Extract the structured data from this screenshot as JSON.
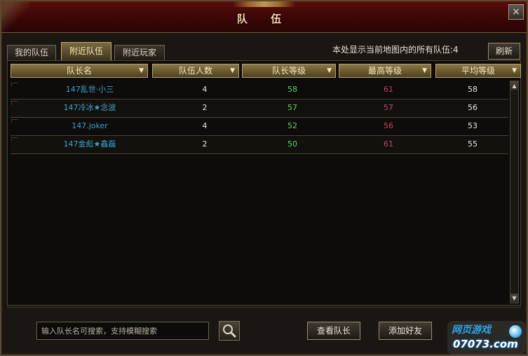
{
  "window": {
    "title": "队  伍",
    "close_label": "×"
  },
  "tabs": [
    {
      "label": "我的队伍"
    },
    {
      "label": "附近队伍"
    },
    {
      "label": "附近玩家"
    }
  ],
  "info": {
    "text": "本处显示当前地图内的所有队伍:4"
  },
  "toolbar": {
    "refresh_label": "刷新"
  },
  "table": {
    "columns": [
      {
        "label": "队长名"
      },
      {
        "label": "队伍人数"
      },
      {
        "label": "队长等级"
      },
      {
        "label": "最高等级"
      },
      {
        "label": "平均等级"
      }
    ],
    "rows": [
      {
        "leader": "147乱世·小三",
        "members": "4",
        "leader_level": "58",
        "max_level": "61",
        "avg_level": "58"
      },
      {
        "leader": "147冷冰★念波",
        "members": "2",
        "leader_level": "57",
        "max_level": "57",
        "avg_level": "56"
      },
      {
        "leader": "147.joker",
        "members": "4",
        "leader_level": "52",
        "max_level": "56",
        "avg_level": "53"
      },
      {
        "leader": "147金彪★鑫磊",
        "members": "2",
        "leader_level": "50",
        "max_level": "61",
        "avg_level": "55"
      }
    ]
  },
  "scrollbar": {
    "up_icon": "▲",
    "down_icon": "▼"
  },
  "search": {
    "placeholder": "输入队长名可搜索，支持模糊搜索",
    "value": ""
  },
  "actions": {
    "view_leader_label": "查看队长",
    "add_friend_label": "添加好友"
  },
  "watermark": {
    "line1": "网页游戏",
    "line2": "07073.com"
  },
  "colors": {
    "name": "#3fa1d0",
    "leader_level": "#5cd25a",
    "max_level": "#c2455f",
    "accent_gold": "#c9a866"
  }
}
